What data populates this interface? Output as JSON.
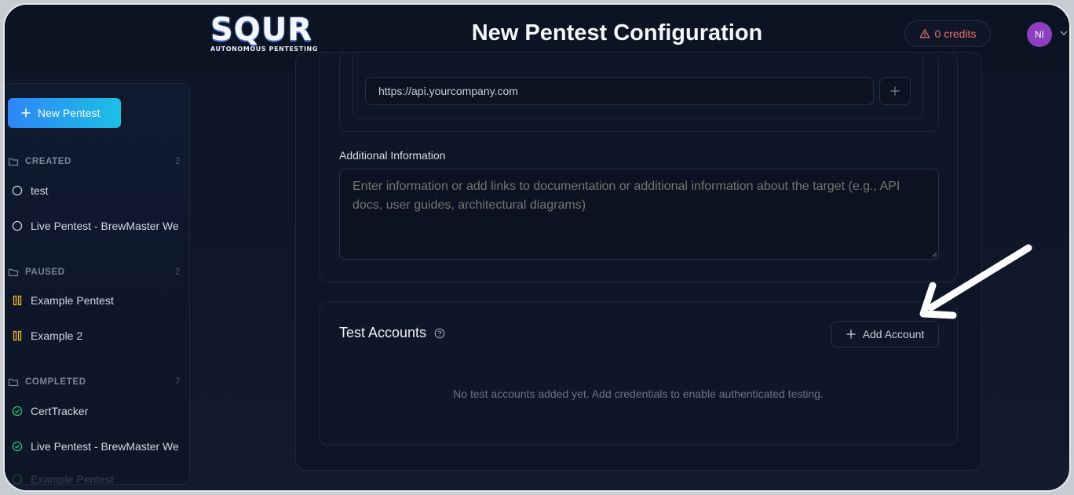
{
  "header": {
    "logo_word": "SQUR",
    "logo_tagline": "AUTONOMOUS PENTESTING",
    "title": "New Pentest Configuration",
    "credits_label": "0 credits",
    "avatar_initials": "NI"
  },
  "sidebar": {
    "new_button_label": "New Pentest",
    "sections": [
      {
        "label": "CREATED",
        "count": "2",
        "items": [
          "test",
          "Live Pentest - BrewMaster We"
        ]
      },
      {
        "label": "PAUSED",
        "count": "2",
        "items": [
          "Example Pentest",
          "Example 2"
        ]
      },
      {
        "label": "COMPLETED",
        "count": "7",
        "items": [
          "CertTracker",
          "Live Pentest - BrewMaster We",
          "Example Pentest"
        ]
      }
    ]
  },
  "form": {
    "url_value": "https://api.yourcompany.com",
    "additional_info_label": "Additional Information",
    "additional_info_placeholder": "Enter information or add links to documentation or additional information about the target (e.g., API docs, user guides, architectural diagrams)",
    "test_accounts_title": "Test Accounts",
    "add_account_label": "Add Account",
    "empty_text": "No test accounts added yet. Add credentials to enable authenticated testing."
  },
  "colors": {
    "accent_gradient_start": "#2f86f6",
    "accent_gradient_end": "#1bc0e6",
    "credits_warning": "#e8726f",
    "paused": "#f0b429",
    "completed": "#2ec27e",
    "avatar": "#8c3fbf"
  }
}
